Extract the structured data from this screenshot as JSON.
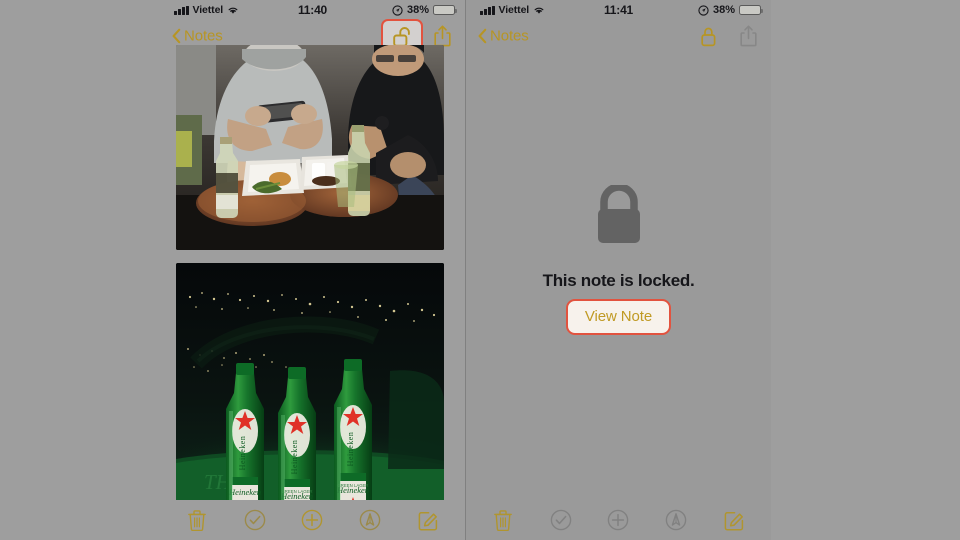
{
  "background_color": "#9e9e9e",
  "accent_gold": "#b79524",
  "highlight_red": "#e2533f",
  "panels": [
    {
      "id": "left",
      "status_bar": {
        "carrier": "Viettel",
        "signal_icon": "signal-bars-icon",
        "wifi_icon": "wifi-icon",
        "time": "11:40",
        "location_icon": "location-services-icon",
        "battery_percent": "38%",
        "battery_icon": "battery-low-power-icon",
        "battery_fill_color": "#e0a91b"
      },
      "nav": {
        "back_label": "Notes",
        "back_chevron_icon": "chevron-left-icon",
        "lock_icon": "unlocked-padlock-icon",
        "lock_highlighted": true,
        "share_icon": "share-up-arrow-icon",
        "share_enabled": true
      },
      "content": {
        "type": "photos",
        "photos": [
          {
            "name": "photo-friends-at-table",
            "alt": "Two people seated at a round wooden table with beer bottles, trays of food and a phone"
          },
          {
            "name": "photo-heineken-bottles-night",
            "alt": "Three green Heineken beer bottles on a table overlooking a city skyline at night"
          }
        ]
      },
      "toolbar": [
        {
          "name": "delete-button",
          "icon": "trash-icon",
          "enabled": true
        },
        {
          "name": "checklist-button",
          "icon": "checkmark-circle-icon",
          "enabled": true
        },
        {
          "name": "add-attachment-button",
          "icon": "plus-circle-icon",
          "enabled": true
        },
        {
          "name": "markup-button",
          "icon": "markup-pen-circle-icon",
          "enabled": true
        },
        {
          "name": "compose-button",
          "icon": "compose-pencil-icon",
          "enabled": true
        }
      ]
    },
    {
      "id": "right",
      "status_bar": {
        "carrier": "Viettel",
        "signal_icon": "signal-bars-icon",
        "wifi_icon": "wifi-icon",
        "time": "11:41",
        "location_icon": "location-services-icon",
        "battery_percent": "38%",
        "battery_icon": "battery-low-power-icon",
        "battery_fill_color": "#e0a91b"
      },
      "nav": {
        "back_label": "Notes",
        "back_chevron_icon": "chevron-left-icon",
        "lock_icon": "locked-padlock-icon",
        "lock_highlighted": false,
        "share_icon": "share-up-arrow-icon",
        "share_enabled": false
      },
      "content": {
        "type": "locked",
        "lock_icon": "large-padlock-icon",
        "message": "This note is locked.",
        "button_label": "View Note"
      },
      "toolbar": [
        {
          "name": "delete-button",
          "icon": "trash-icon",
          "enabled": true
        },
        {
          "name": "checklist-button",
          "icon": "checkmark-circle-icon",
          "enabled": false
        },
        {
          "name": "add-attachment-button",
          "icon": "plus-circle-icon",
          "enabled": false
        },
        {
          "name": "markup-button",
          "icon": "markup-pen-circle-icon",
          "enabled": false
        },
        {
          "name": "compose-button",
          "icon": "compose-pencil-icon",
          "enabled": true
        }
      ]
    }
  ]
}
